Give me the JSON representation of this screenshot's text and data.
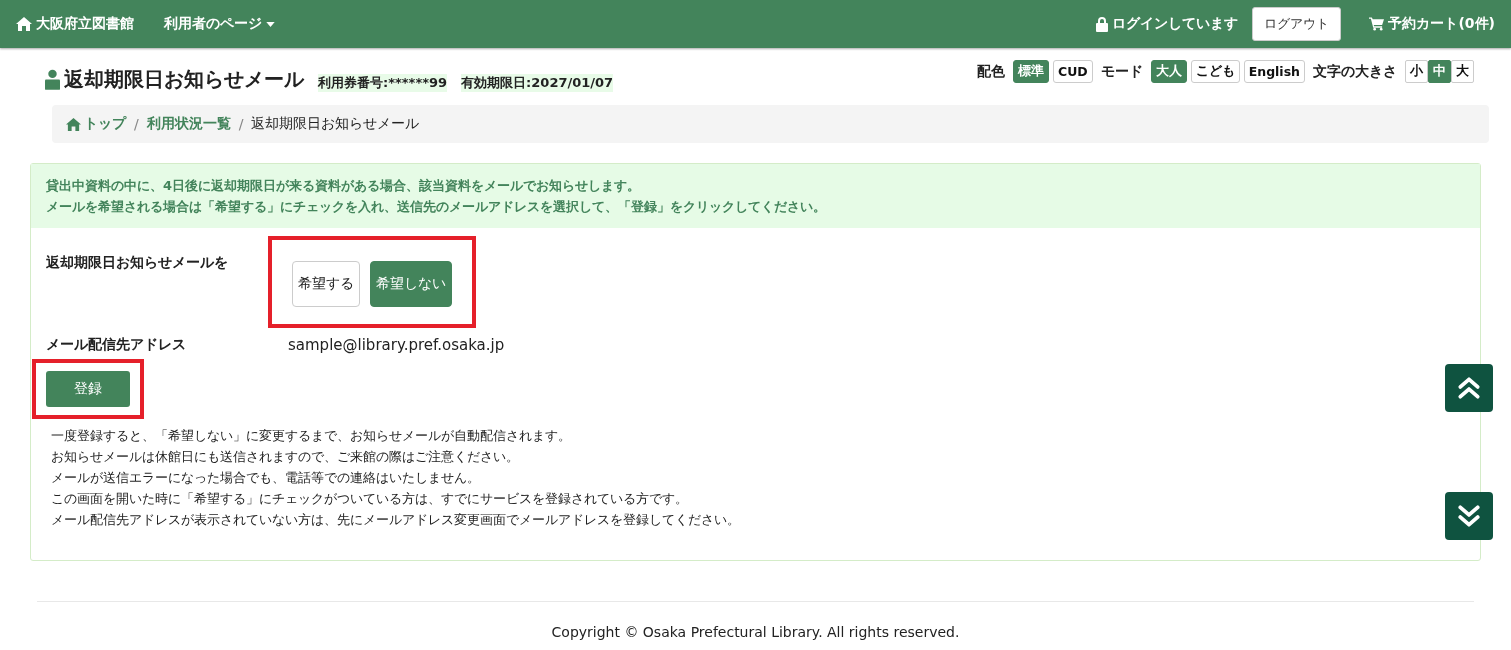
{
  "navbar": {
    "brand": "大阪府立図書館",
    "menu": "利用者のページ",
    "login_status": "ログインしています",
    "logout": "ログアウト",
    "cart": "予約カート(0件)"
  },
  "header": {
    "title": "返却期限日お知らせメール",
    "card_number": "利用券番号:******99",
    "expiry": "有効期限日:2027/01/07"
  },
  "settings": [
    {
      "label": "配色",
      "options": [
        {
          "label": "標準",
          "selected": true
        },
        {
          "label": "CUD",
          "selected": false
        }
      ]
    },
    {
      "label": "モード",
      "options": [
        {
          "label": "大人",
          "selected": true
        },
        {
          "label": "こども",
          "selected": false
        },
        {
          "label": "English",
          "selected": false
        }
      ]
    },
    {
      "label": "文字の大きさ",
      "options": [
        {
          "label": "小",
          "selected": false
        },
        {
          "label": "中",
          "selected": true
        },
        {
          "label": "大",
          "selected": false
        }
      ]
    }
  ],
  "breadcrumb": [
    {
      "label": "トップ",
      "link": true,
      "separator": "/"
    },
    {
      "label": "利用状況一覧",
      "link": true,
      "separator": "/"
    },
    {
      "label": "返却期限日お知らせメール",
      "link": false
    }
  ],
  "notice": [
    "貸出中資料の中に、4日後に返却期限日が来る資料がある場合、該当資料をメールでお知らせします。",
    "メールを希望される場合は「希望する」にチェックを入れ、送信先のメールアドレスを選択して、「登録」をクリックしてください。"
  ],
  "form": {
    "preference_label": "返却期限日お知らせメールを",
    "choices": [
      {
        "label": "希望する",
        "selected": false
      },
      {
        "label": "希望しない",
        "selected": true
      }
    ],
    "address_label": "メール配信先アドレス",
    "address": "sample@library.pref.osaka.jp",
    "submit": "登録"
  },
  "notes": [
    "一度登録すると、「希望しない」に変更するまで、お知らせメールが自動配信されます。",
    "お知らせメールは休館日にも送信されますので、ご来館の際はご注意ください。",
    "メールが送信エラーになった場合でも、電話等での連絡はいたしません。",
    "この画面を開いた時に「希望する」にチェックがついている方は、すでにサービスを登録されている方です。",
    "メール配信先アドレスが表示されていない方は、先にメールアドレス変更画面でメールアドレスを登録してください。"
  ],
  "footer": {
    "copyright": "Copyright © Osaka Prefectural Library. All rights reserved."
  }
}
